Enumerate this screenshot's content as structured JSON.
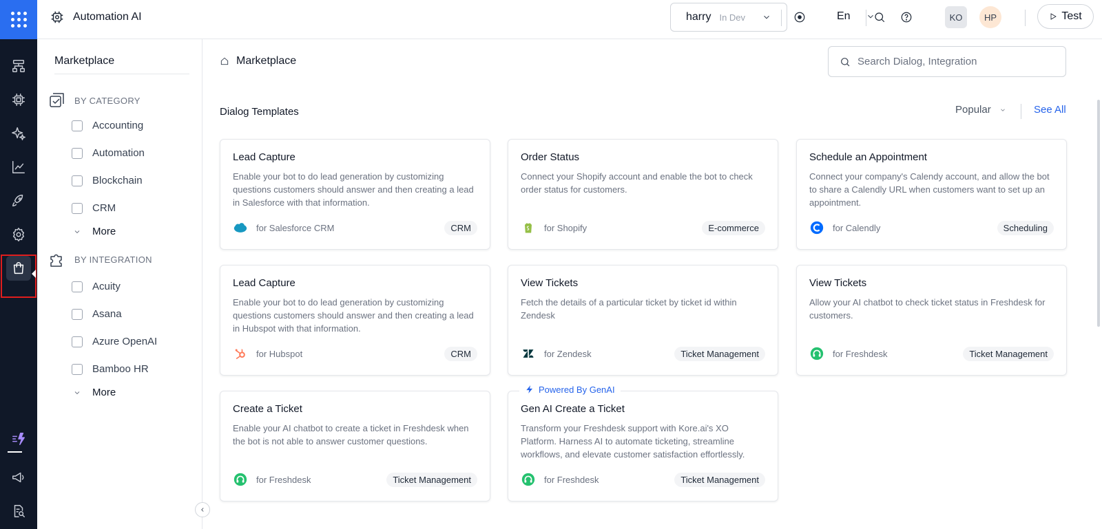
{
  "app": {
    "title": "Automation AI"
  },
  "topbar": {
    "env_name": "harry",
    "env_state": "In Dev",
    "language": "En",
    "avatars": [
      "KO",
      "HP"
    ],
    "test_label": "Test"
  },
  "filter": {
    "title": "Marketplace",
    "by_category": {
      "label": "BY CATEGORY",
      "items": [
        "Accounting",
        "Automation",
        "Blockchain",
        "CRM"
      ],
      "more": "More"
    },
    "by_integration": {
      "label": "BY INTEGRATION",
      "items": [
        "Acuity",
        "Asana",
        "Azure OpenAI",
        "Bamboo HR"
      ],
      "more": "More"
    }
  },
  "main": {
    "breadcrumb": "Marketplace",
    "search_placeholder": "Search Dialog, Integration",
    "section_title": "Dialog Templates",
    "sort": "Popular",
    "see_all": "See All",
    "cards": [
      {
        "title": "Lead Capture",
        "desc": "Enable your bot to do lead generation by customizing questions customers should answer and then creating a lead in Salesforce with that information.",
        "provider": "for Salesforce CRM",
        "tag": "CRM",
        "logo": "salesforce-logo-icon"
      },
      {
        "title": "Order Status",
        "desc": "Connect your Shopify account and enable the bot to check order status for customers.",
        "provider": "for Shopify",
        "tag": "E-commerce",
        "logo": "shopify-logo-icon"
      },
      {
        "title": "Schedule an Appointment",
        "desc": "Connect your company's Calendy account, and allow the bot to share a Calendly URL when customers want to set up an appointment.",
        "provider": "for Calendly",
        "tag": "Scheduling",
        "logo": "calendly-logo-icon"
      },
      {
        "title": "Lead Capture",
        "desc": "Enable your bot to do lead generation by customizing questions customers should answer and then creating a lead in Hubspot with that information.",
        "provider": "for Hubspot",
        "tag": "CRM",
        "logo": "hubspot-logo-icon"
      },
      {
        "title": "View Tickets",
        "desc": "Fetch the details of a particular ticket by ticket id within Zendesk",
        "provider": "for Zendesk",
        "tag": "Ticket Management",
        "logo": "zendesk-logo-icon"
      },
      {
        "title": "View Tickets",
        "desc": "Allow your AI chatbot to check ticket status in Freshdesk for customers.",
        "provider": "for Freshdesk",
        "tag": "Ticket Management",
        "logo": "freshdesk-logo-icon"
      },
      {
        "title": "Create a Ticket",
        "desc": "Enable your AI chatbot to create a ticket in Freshdesk when the bot is not able to answer customer questions.",
        "provider": "for Freshdesk",
        "tag": "Ticket Management",
        "logo": "freshdesk-logo-icon"
      },
      {
        "title": "Gen AI Create a Ticket",
        "badge": "Powered By GenAI",
        "desc": "Transform your Freshdesk support with Kore.ai's XO Platform. Harness AI to automate ticketing, streamline workflows, and elevate customer satisfaction effortlessly.",
        "provider": "for Freshdesk",
        "tag": "Ticket Management",
        "logo": "freshdesk-logo-icon"
      }
    ]
  },
  "colors": {
    "rail_bg": "#101828",
    "brand_blue": "#2a6ef0",
    "link_blue": "#2563eb",
    "highlight_red": "#e11d1d"
  }
}
